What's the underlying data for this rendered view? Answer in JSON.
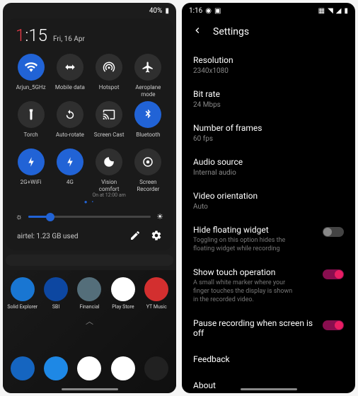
{
  "left": {
    "status": {
      "battery": "40%"
    },
    "clock": {
      "h": "1",
      "m": "15"
    },
    "date": "Fri, 16 Apr",
    "qs": [
      {
        "label": "Arjun_5GHz",
        "on": true,
        "icon": "wifi"
      },
      {
        "label": "Mobile data",
        "on": false,
        "icon": "swap"
      },
      {
        "label": "Hotspot",
        "on": false,
        "icon": "hotspot"
      },
      {
        "label": "Aeroplane mode",
        "on": false,
        "icon": "plane"
      },
      {
        "label": "Torch",
        "on": false,
        "icon": "torch"
      },
      {
        "label": "Auto-rotate",
        "on": false,
        "icon": "rotate"
      },
      {
        "label": "Screen Cast",
        "on": false,
        "icon": "cast"
      },
      {
        "label": "Bluetooth",
        "on": true,
        "icon": "bt"
      },
      {
        "label": "2G+WiFi",
        "on": true,
        "icon": "bolt"
      },
      {
        "label": "4G",
        "on": true,
        "icon": "bolt"
      },
      {
        "label": "Vision comfort",
        "sub": "On at 12:00 am",
        "on": false,
        "icon": "moon"
      },
      {
        "label": "Screen Recorder",
        "on": false,
        "icon": "record"
      }
    ],
    "data_usage": "airtel: 1.23 GB used",
    "apps": [
      {
        "label": "Solid Explorer",
        "bg": "#1976d2"
      },
      {
        "label": "SBI",
        "bg": "#0d47a1"
      },
      {
        "label": "Financial",
        "bg": "#546e7a"
      },
      {
        "label": "Play Store",
        "bg": "#fff"
      },
      {
        "label": "YT Music",
        "bg": "#d32f2f"
      }
    ],
    "dock": [
      {
        "bg": "#1565c0"
      },
      {
        "bg": "#1e88e5"
      },
      {
        "bg": "#fff"
      },
      {
        "bg": "#fff"
      },
      {
        "bg": "#212121"
      }
    ]
  },
  "right": {
    "status_time": "1:16",
    "title": "Settings",
    "items": [
      {
        "label": "Resolution",
        "value": "2340x1080"
      },
      {
        "label": "Bit rate",
        "value": "24 Mbps"
      },
      {
        "label": "Number of frames",
        "value": "60 fps"
      },
      {
        "label": "Audio source",
        "value": "Internal audio"
      },
      {
        "label": "Video orientation",
        "value": "Auto"
      }
    ],
    "toggles": [
      {
        "label": "Hide floating widget",
        "desc": "Toggling on this option hides the floating widget while recording",
        "on": false
      },
      {
        "label": "Show touch operation",
        "desc": "A small white marker where your finger touches the display is shown in the recorded video.",
        "on": true
      },
      {
        "label": "Pause recording when screen is off",
        "desc": "",
        "on": true
      }
    ],
    "links": [
      {
        "label": "Feedback"
      },
      {
        "label": "About"
      }
    ]
  }
}
